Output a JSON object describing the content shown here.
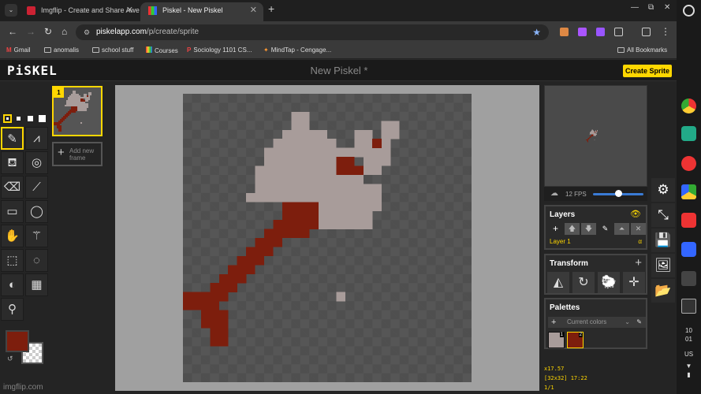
{
  "tabs": [
    {
      "title": "Imgflip - Create and Share Awe",
      "active": false
    },
    {
      "title": "Piskel - New Piskel",
      "active": true
    }
  ],
  "address": {
    "host": "piskelapp.com",
    "path": "/p/create/sprite"
  },
  "bookmarks": [
    "Gmail",
    "anomalis",
    "school stuff",
    "Courses",
    "Sociology 1101 CS...",
    "MindTap - Cengage...",
    "All Bookmarks"
  ],
  "app": {
    "logo": "PiSKEL",
    "title": "New Piskel *",
    "create_button": "Create Sprite"
  },
  "frames": {
    "current_number": "1",
    "add_label_1": "Add new",
    "add_label_2": "frame"
  },
  "preview": {
    "fps_label": "12 FPS",
    "fps_value": 12
  },
  "layers": {
    "title": "Layers",
    "layer_name": "Layer 1",
    "alpha_label": "α"
  },
  "transform": {
    "title": "Transform"
  },
  "palettes": {
    "title": "Palettes",
    "current": "Current colors",
    "swatches": [
      {
        "number": "1",
        "color": "#a89c9a"
      },
      {
        "number": "2",
        "color": "#7d1e0d"
      }
    ]
  },
  "status": {
    "zoom": "x17.57",
    "cursor": "[32x32] 17:22",
    "frame": "1/1"
  },
  "colors": {
    "primary": "#7d1e0d",
    "light": "#a89c9a",
    "accent": "#ffd700"
  },
  "shelf": {
    "time_hour": "10",
    "time_min": "01",
    "locale": "US"
  },
  "watermark": "imgflip.com",
  "sprite": {
    "grid": 32,
    "light_pixels": [
      [
        12,
        2
      ],
      [
        13,
        2
      ],
      [
        12,
        3
      ],
      [
        13,
        3
      ],
      [
        22,
        3
      ],
      [
        23,
        3
      ],
      [
        22,
        4
      ],
      [
        23,
        4
      ],
      [
        11,
        4
      ],
      [
        12,
        4
      ],
      [
        13,
        4
      ],
      [
        14,
        4
      ],
      [
        15,
        4
      ],
      [
        19,
        4
      ],
      [
        20,
        4
      ],
      [
        10,
        5
      ],
      [
        11,
        5
      ],
      [
        12,
        5
      ],
      [
        13,
        5
      ],
      [
        14,
        5
      ],
      [
        15,
        5
      ],
      [
        16,
        5
      ],
      [
        19,
        5
      ],
      [
        20,
        5
      ],
      [
        22,
        5
      ],
      [
        9,
        6
      ],
      [
        10,
        6
      ],
      [
        11,
        6
      ],
      [
        12,
        6
      ],
      [
        13,
        6
      ],
      [
        14,
        6
      ],
      [
        15,
        6
      ],
      [
        16,
        6
      ],
      [
        17,
        6
      ],
      [
        18,
        6
      ],
      [
        19,
        6
      ],
      [
        20,
        6
      ],
      [
        21,
        6
      ],
      [
        22,
        6
      ],
      [
        9,
        7
      ],
      [
        10,
        7
      ],
      [
        11,
        7
      ],
      [
        12,
        7
      ],
      [
        13,
        7
      ],
      [
        14,
        7
      ],
      [
        15,
        7
      ],
      [
        16,
        7
      ],
      [
        17,
        7
      ],
      [
        18,
        7
      ],
      [
        20,
        7
      ],
      [
        21,
        7
      ],
      [
        22,
        7
      ],
      [
        8,
        8
      ],
      [
        9,
        8
      ],
      [
        10,
        8
      ],
      [
        11,
        8
      ],
      [
        12,
        8
      ],
      [
        13,
        8
      ],
      [
        14,
        8
      ],
      [
        15,
        8
      ],
      [
        16,
        8
      ],
      [
        17,
        8
      ],
      [
        18,
        8
      ],
      [
        20,
        8
      ],
      [
        21,
        8
      ],
      [
        8,
        9
      ],
      [
        9,
        9
      ],
      [
        10,
        9
      ],
      [
        11,
        9
      ],
      [
        12,
        9
      ],
      [
        13,
        9
      ],
      [
        14,
        9
      ],
      [
        15,
        9
      ],
      [
        16,
        9
      ],
      [
        17,
        9
      ],
      [
        18,
        9
      ],
      [
        19,
        9
      ],
      [
        8,
        10
      ],
      [
        9,
        10
      ],
      [
        10,
        10
      ],
      [
        11,
        10
      ],
      [
        12,
        10
      ],
      [
        13,
        10
      ],
      [
        14,
        10
      ],
      [
        15,
        10
      ],
      [
        16,
        10
      ],
      [
        17,
        10
      ],
      [
        18,
        10
      ],
      [
        19,
        10
      ],
      [
        20,
        10
      ],
      [
        21,
        10
      ],
      [
        7,
        11
      ],
      [
        8,
        11
      ],
      [
        9,
        11
      ],
      [
        10,
        11
      ],
      [
        11,
        11
      ],
      [
        12,
        11
      ],
      [
        13,
        11
      ],
      [
        14,
        11
      ],
      [
        15,
        11
      ],
      [
        16,
        11
      ],
      [
        17,
        11
      ],
      [
        18,
        11
      ],
      [
        19,
        11
      ],
      [
        20,
        11
      ],
      [
        21,
        11
      ],
      [
        15,
        12
      ],
      [
        16,
        12
      ],
      [
        17,
        12
      ],
      [
        18,
        12
      ],
      [
        19,
        12
      ],
      [
        20,
        12
      ],
      [
        21,
        12
      ],
      [
        15,
        13
      ],
      [
        16,
        13
      ],
      [
        17,
        13
      ],
      [
        18,
        13
      ],
      [
        19,
        13
      ],
      [
        20,
        13
      ],
      [
        15,
        14
      ],
      [
        16,
        14
      ],
      [
        17,
        14
      ],
      [
        18,
        14
      ],
      [
        19,
        14
      ],
      [
        20,
        14
      ],
      [
        17,
        22
      ]
    ],
    "dark_pixels": [
      [
        21,
        5
      ],
      [
        17,
        7
      ],
      [
        18,
        7
      ],
      [
        17,
        8
      ],
      [
        18,
        8
      ],
      [
        19,
        8
      ],
      [
        11,
        12
      ],
      [
        12,
        12
      ],
      [
        13,
        12
      ],
      [
        14,
        12
      ],
      [
        11,
        13
      ],
      [
        12,
        13
      ],
      [
        13,
        13
      ],
      [
        14,
        13
      ],
      [
        10,
        14
      ],
      [
        11,
        14
      ],
      [
        12,
        14
      ],
      [
        13,
        14
      ],
      [
        14,
        14
      ],
      [
        9,
        15
      ],
      [
        10,
        15
      ],
      [
        11,
        15
      ],
      [
        12,
        15
      ],
      [
        13,
        15
      ],
      [
        8,
        16
      ],
      [
        9,
        16
      ],
      [
        10,
        16
      ],
      [
        7,
        17
      ],
      [
        8,
        17
      ],
      [
        9,
        17
      ],
      [
        6,
        18
      ],
      [
        7,
        18
      ],
      [
        8,
        18
      ],
      [
        5,
        19
      ],
      [
        6,
        19
      ],
      [
        7,
        19
      ],
      [
        4,
        20
      ],
      [
        5,
        20
      ],
      [
        6,
        20
      ],
      [
        3,
        21
      ],
      [
        4,
        21
      ],
      [
        5,
        21
      ],
      [
        0,
        22
      ],
      [
        1,
        22
      ],
      [
        2,
        22
      ],
      [
        3,
        22
      ],
      [
        4,
        22
      ],
      [
        0,
        23
      ],
      [
        1,
        23
      ],
      [
        2,
        23
      ],
      [
        3,
        23
      ],
      [
        2,
        24
      ],
      [
        3,
        24
      ],
      [
        4,
        24
      ],
      [
        2,
        25
      ],
      [
        3,
        25
      ],
      [
        4,
        25
      ],
      [
        3,
        26
      ],
      [
        4,
        26
      ],
      [
        3,
        27
      ],
      [
        4,
        27
      ]
    ]
  }
}
